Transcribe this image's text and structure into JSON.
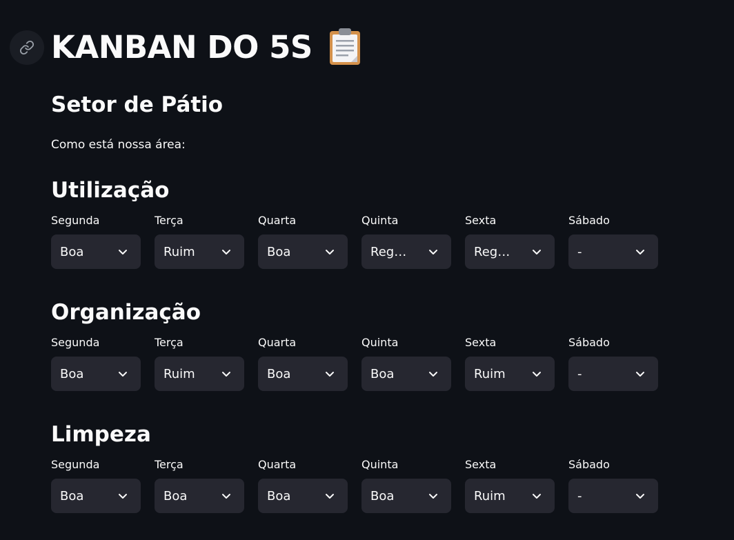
{
  "header": {
    "title": "KANBAN DO 5S",
    "subtitle": "Setor de Pátio",
    "caption": "Como está nossa área:"
  },
  "icons": {
    "anchor": "link-icon",
    "title_emoji": "clipboard-icon",
    "select_arrow": "chevron-down-icon"
  },
  "colors": {
    "background": "#0e1117",
    "select_background": "#262730",
    "text": "#fafafa"
  },
  "sections": [
    {
      "title": "Utilização",
      "days": [
        {
          "label": "Segunda",
          "value": "Boa"
        },
        {
          "label": "Terça",
          "value": "Ruim"
        },
        {
          "label": "Quarta",
          "value": "Boa"
        },
        {
          "label": "Quinta",
          "value": "Reg…"
        },
        {
          "label": "Sexta",
          "value": "Reg…"
        },
        {
          "label": "Sábado",
          "value": "-"
        }
      ]
    },
    {
      "title": "Organização",
      "days": [
        {
          "label": "Segunda",
          "value": "Boa"
        },
        {
          "label": "Terça",
          "value": "Ruim"
        },
        {
          "label": "Quarta",
          "value": "Boa"
        },
        {
          "label": "Quinta",
          "value": "Boa"
        },
        {
          "label": "Sexta",
          "value": "Ruim"
        },
        {
          "label": "Sábado",
          "value": "-"
        }
      ]
    },
    {
      "title": "Limpeza",
      "days": [
        {
          "label": "Segunda",
          "value": "Boa"
        },
        {
          "label": "Terça",
          "value": "Boa"
        },
        {
          "label": "Quarta",
          "value": "Boa"
        },
        {
          "label": "Quinta",
          "value": "Boa"
        },
        {
          "label": "Sexta",
          "value": "Ruim"
        },
        {
          "label": "Sábado",
          "value": "-"
        }
      ]
    }
  ]
}
